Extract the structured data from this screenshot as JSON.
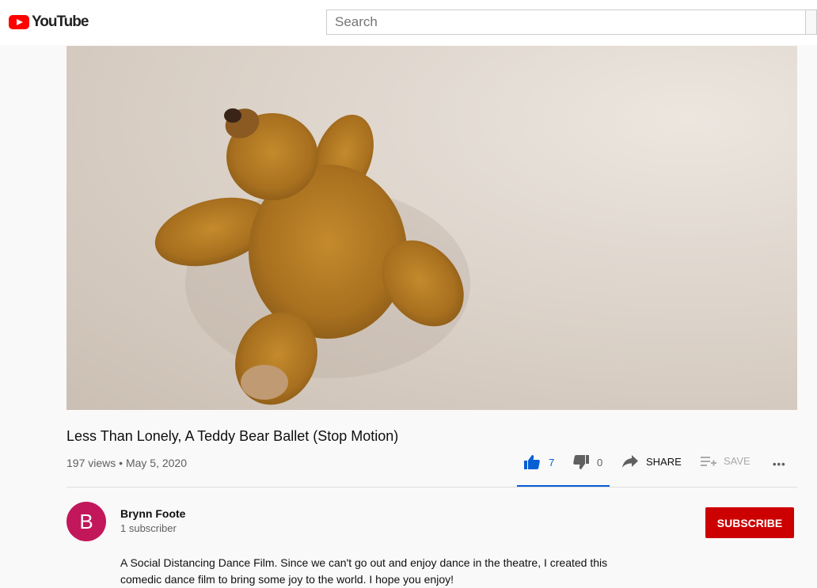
{
  "header": {
    "logo_text": "YouTube",
    "search": {
      "placeholder": "Search"
    }
  },
  "player": {
    "thumbnail_subject": "teddy-bear-lying-on-sheet"
  },
  "video": {
    "title": "Less Than Lonely, A Teddy Bear Ballet (Stop Motion)",
    "views": "197 views",
    "separator": "•",
    "date": "May 5, 2020"
  },
  "actions": {
    "like_count": "7",
    "dislike_count": "0",
    "share_label": "SHARE",
    "save_label": "SAVE",
    "more_label": "•••"
  },
  "channel": {
    "avatar_letter": "B",
    "name": "Brynn Foote",
    "subscribers": "1 subscriber",
    "subscribe_label": "SUBSCRIBE"
  },
  "description": {
    "line1": "A Social Distancing Dance Film. Since we can't go out and enjoy dance in the theatre, I created this",
    "line2": "comedic dance film to bring some joy to the world. I hope you enjoy!"
  },
  "colors": {
    "brand_red": "#ff0000",
    "subscribe_red": "#cc0000",
    "like_active": "#065fd4",
    "avatar_bg": "#c2185b"
  }
}
